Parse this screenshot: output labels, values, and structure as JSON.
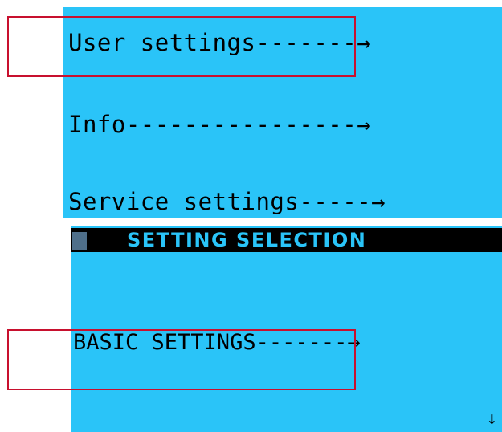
{
  "top_menu": {
    "items": [
      {
        "label": "User settings",
        "leader": "-------",
        "arrow": "→"
      },
      {
        "label": "Info",
        "leader": "----------------",
        "arrow": "→"
      },
      {
        "label": "Service settings",
        "leader": "-----",
        "arrow": "→"
      }
    ]
  },
  "bottom_menu": {
    "title": "SETTING SELECTION",
    "item_label": "BASIC SETTINGS",
    "item_leader": "-------",
    "item_arrow": "→",
    "scroll_indicator": "↓"
  },
  "colors": {
    "screen_background": "#2ac4f8",
    "title_bar_background": "#000000",
    "text": "#000000",
    "highlight_box": "#c8102e"
  }
}
